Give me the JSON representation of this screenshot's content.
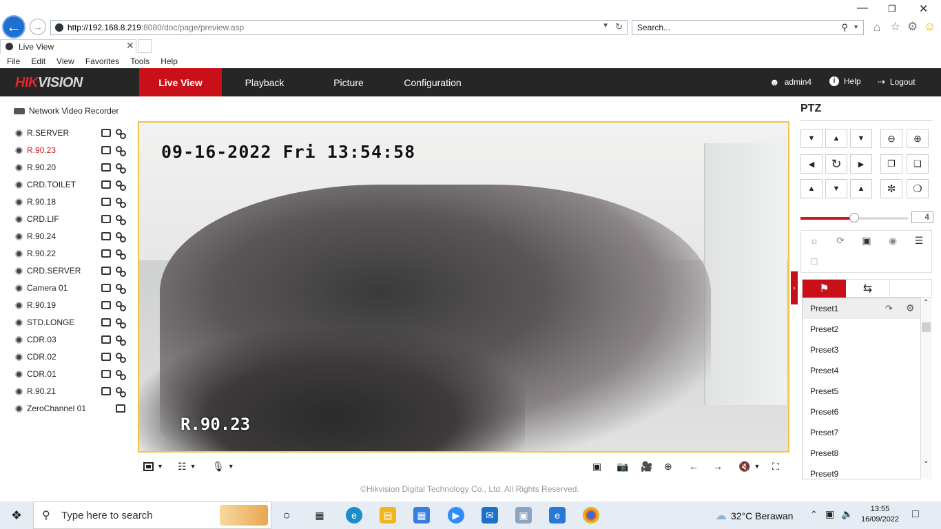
{
  "browser": {
    "url_ip": "http://192.168.8.219",
    "url_rest": ":8080/doc/page/preview.asp",
    "search_placeholder": "Search...",
    "tab_title": "Live View",
    "menu": [
      "File",
      "Edit",
      "View",
      "Favorites",
      "Tools",
      "Help"
    ]
  },
  "header": {
    "logo_hik": "HIK",
    "logo_vision": "VISION",
    "tabs": [
      "Live View",
      "Playback",
      "Picture",
      "Configuration"
    ],
    "active_tab": "Live View",
    "user": "admin4",
    "help": "Help",
    "logout": "Logout"
  },
  "sidebar": {
    "title": "Network Video Recorder",
    "cameras": [
      {
        "label": "R.SERVER",
        "active": false
      },
      {
        "label": "R.90.23",
        "active": true
      },
      {
        "label": "R.90.20",
        "active": false
      },
      {
        "label": "CRD.TOILET",
        "active": false
      },
      {
        "label": "R.90.18",
        "active": false
      },
      {
        "label": "CRD.LIF",
        "active": false
      },
      {
        "label": "R.90.24",
        "active": false
      },
      {
        "label": "R.90.22",
        "active": false
      },
      {
        "label": "CRD.SERVER",
        "active": false
      },
      {
        "label": "Camera 01",
        "active": false
      },
      {
        "label": "R.90.19",
        "active": false
      },
      {
        "label": "STD.LONGE",
        "active": false
      },
      {
        "label": "CDR.03",
        "active": false
      },
      {
        "label": "CDR.02",
        "active": false
      },
      {
        "label": "CDR.01",
        "active": false
      },
      {
        "label": "R.90.21",
        "active": false
      },
      {
        "label": "ZeroChannel 01",
        "active": false
      }
    ]
  },
  "video": {
    "osd_time": "09-16-2022 Fri 13:54:58",
    "osd_name": "R.90.23"
  },
  "footer": "©Hikvision Digital Technology Co., Ltd. All Rights Reserved.",
  "ptz": {
    "title": "PTZ",
    "speed": "4",
    "speed_level": 0.5,
    "presets": [
      "Preset1",
      "Preset2",
      "Preset3",
      "Preset4",
      "Preset5",
      "Preset6",
      "Preset7",
      "Preset8",
      "Preset9"
    ],
    "selected_preset": "Preset1"
  },
  "taskbar": {
    "search_placeholder": "Type here to search",
    "weather": "32°C  Berawan",
    "time": "13:55",
    "date": "16/09/2022"
  },
  "colors": {
    "accent": "#c90f17",
    "header_bg": "#262626",
    "video_border": "#f3c24a"
  }
}
